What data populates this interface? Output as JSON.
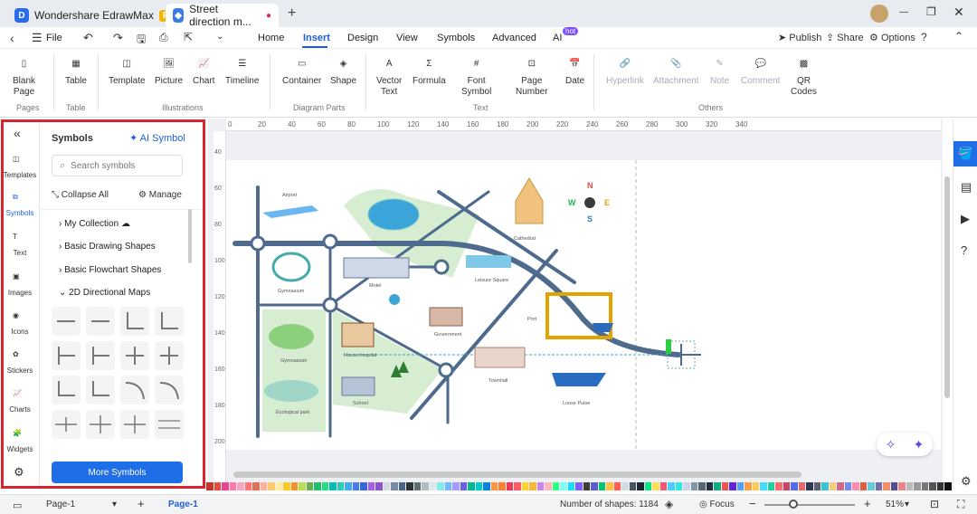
{
  "app": {
    "name": "Wondershare EdrawMax",
    "badge": "Pro",
    "doc_tab": "Street direction m..."
  },
  "menu": {
    "file": "File",
    "items": [
      "Home",
      "Insert",
      "Design",
      "View",
      "Symbols",
      "Advanced",
      "AI"
    ],
    "ai_badge": "hot",
    "active": "Insert",
    "publish": "Publish",
    "share": "Share",
    "options": "Options"
  },
  "ribbon": {
    "buttons": [
      {
        "label": "Blank\nPage"
      },
      {
        "label": "Table"
      },
      {
        "label": "Template"
      },
      {
        "label": "Picture"
      },
      {
        "label": "Chart"
      },
      {
        "label": "Timeline"
      },
      {
        "label": "Container"
      },
      {
        "label": "Shape"
      },
      {
        "label": "Vector\nText"
      },
      {
        "label": "Formula"
      },
      {
        "label": "Font\nSymbol"
      },
      {
        "label": "Page\nNumber"
      },
      {
        "label": "Date"
      },
      {
        "label": "Hyperlink"
      },
      {
        "label": "Attachment"
      },
      {
        "label": "Note"
      },
      {
        "label": "Comment"
      },
      {
        "label": "QR\nCodes"
      }
    ],
    "groups": [
      "Pages",
      "Table",
      "Illustrations",
      "Diagram Parts",
      "Text",
      "Others"
    ]
  },
  "rail": [
    "Templates",
    "Symbols",
    "Text",
    "Images",
    "Icons",
    "Stickers",
    "Charts",
    "Widgets"
  ],
  "symbols": {
    "title": "Symbols",
    "ai_symbol": "AI Symbol",
    "search_placeholder": "Search symbols",
    "collapse_all": "Collapse All",
    "manage": "Manage",
    "categories": [
      "My Collection",
      "Basic Drawing Shapes",
      "Basic Flowchart Shapes",
      "2D Directional Maps"
    ],
    "more": "More Symbols"
  },
  "ruler": {
    "h": [
      "0",
      "20",
      "40",
      "60",
      "80",
      "100",
      "120",
      "140",
      "160",
      "180",
      "200",
      "220",
      "240",
      "260",
      "280",
      "300",
      "320",
      "340"
    ],
    "v": [
      "40",
      "60",
      "80",
      "100",
      "120",
      "140",
      "160",
      "180",
      "200"
    ]
  },
  "map": {
    "labels": [
      "Airport",
      "Cathedral",
      "Gymnasium",
      "Motel",
      "Leisure Square",
      "Government",
      "Port",
      "Gymnasium",
      "House.hospital",
      "Townhall",
      "School",
      "Ecological park",
      "Loose Pulse"
    ]
  },
  "status": {
    "page_tab": "Page-1",
    "page_active": "Page-1",
    "shapes": "Number of shapes: 1184",
    "focus": "Focus",
    "zoom": "51%"
  },
  "palette": [
    "#c0392b",
    "#e74c3c",
    "#e84393",
    "#fd79a8",
    "#f8a5c2",
    "#ff7675",
    "#e17055",
    "#fab1a0",
    "#fdcb6e",
    "#ffeaa7",
    "#f9ca24",
    "#f0932b",
    "#badc58",
    "#6ab04c",
    "#20bf6b",
    "#26de81",
    "#0fb9b1",
    "#2bcbba",
    "#45aaf2",
    "#4b7bec",
    "#3867d6",
    "#a55eea",
    "#8854d0",
    "#d1d8e0",
    "#778ca3",
    "#4b6584",
    "#2d3436",
    "#636e72",
    "#b2bec3",
    "#dfe6e9",
    "#81ecec",
    "#74b9ff",
    "#a29bfe",
    "#6c5ce7",
    "#00b894",
    "#00cec9",
    "#0984e3",
    "#fd9644",
    "#fa8231",
    "#eb3b5a",
    "#fc5c65",
    "#fed330",
    "#f7b731",
    "#cd84f1",
    "#ffb8b8",
    "#32ff7e",
    "#7efff5",
    "#18dcff",
    "#7d5fff",
    "#3d3d3d",
    "#575fcf",
    "#05c46b",
    "#ffc048",
    "#ff5e57",
    "#d2dae2",
    "#485460",
    "#1e272e",
    "#0be881",
    "#ffdd59",
    "#ef5777",
    "#4bcffa",
    "#34e7e4",
    "#c8d6e5",
    "#8395a7",
    "#576574",
    "#222f3e",
    "#10ac84",
    "#ee5253",
    "#5f27cd",
    "#54a0ff",
    "#ff9f43",
    "#feca57",
    "#48dbfb",
    "#1dd1a1",
    "#ff6b6b",
    "#c44569",
    "#546de5",
    "#e66767",
    "#303952",
    "#596275",
    "#3dc1d3",
    "#f5cd79",
    "#cf6a87",
    "#778beb",
    "#f78fb3",
    "#e15f41",
    "#63cdda",
    "#786fa6",
    "#f19066",
    "#574b90",
    "#ea8685",
    "#bbb",
    "#999",
    "#777",
    "#555",
    "#333",
    "#111"
  ]
}
